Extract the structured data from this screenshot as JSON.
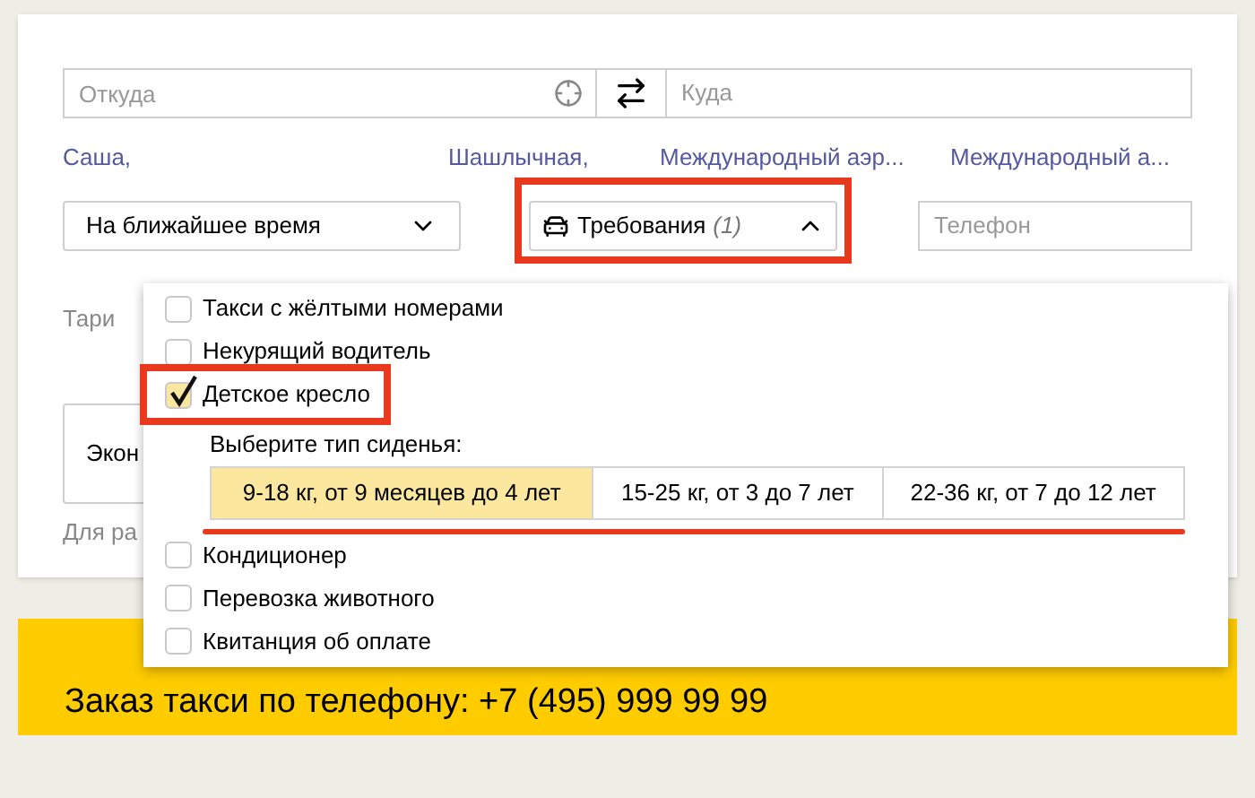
{
  "route": {
    "from": {
      "placeholder": "Откуда"
    },
    "to": {
      "placeholder": "Куда"
    }
  },
  "suggestions": [
    "Саша,",
    "Шашлычная,",
    "Международный аэр...",
    "Международный а..."
  ],
  "time_select": {
    "value": "На ближайшее время"
  },
  "requirements": {
    "label": "Требования",
    "count": "(1)",
    "expanded": true
  },
  "phone": {
    "placeholder": "Телефон"
  },
  "tariff_label": "Тари",
  "tariff_select": {
    "value": "Экон"
  },
  "note": "Для ра",
  "banner": {
    "text": "Заказ такси по телефону: +7 (495) 999 99 99"
  },
  "options": [
    {
      "kind": "checkbox",
      "label": "Такси с жёлтыми номерами",
      "checked": false
    },
    {
      "kind": "checkbox",
      "label": "Некурящий водитель",
      "checked": false
    },
    {
      "kind": "checkbox",
      "label": "Детское кресло",
      "checked": true,
      "highlighted": true
    },
    {
      "kind": "seat",
      "label": "Выберите тип сиденья:",
      "choices": [
        {
          "label": "9-18 кг, от 9 месяцев до 4 лет",
          "selected": true
        },
        {
          "label": "15-25 кг, от 3 до 7 лет",
          "selected": false
        },
        {
          "label": "22-36 кг, от 7 до 12 лет",
          "selected": false
        }
      ]
    },
    {
      "kind": "checkbox",
      "label": "Кондиционер",
      "checked": false
    },
    {
      "kind": "checkbox",
      "label": "Перевозка животного",
      "checked": false
    },
    {
      "kind": "checkbox",
      "label": "Квитанция об оплате",
      "checked": false
    }
  ]
}
